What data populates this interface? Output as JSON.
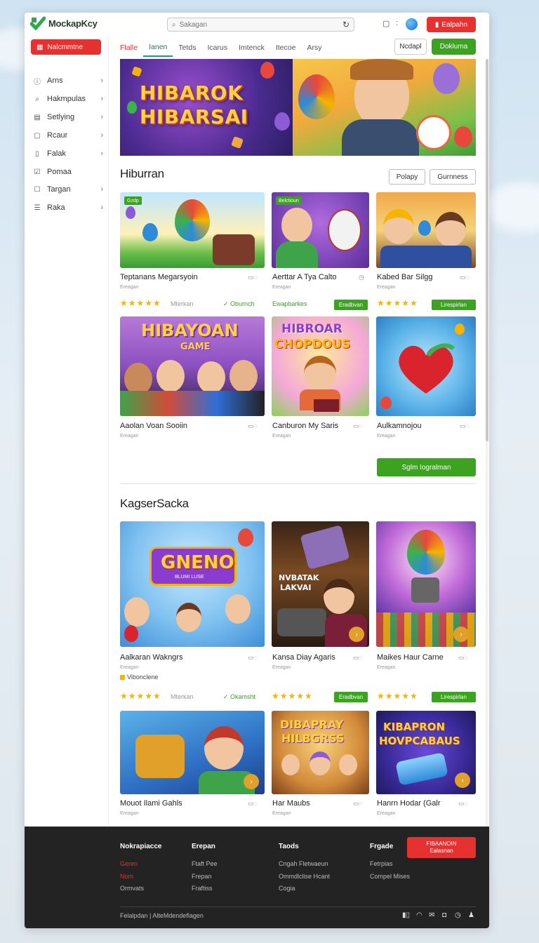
{
  "header": {
    "logo_text": "MockapKcy",
    "search_placeholder": "Sakagan",
    "account_label": "Ealpahn"
  },
  "sidebar": {
    "active_label": "Nalcmmtne",
    "items": [
      {
        "label": "Arns",
        "icon": "info-icon"
      },
      {
        "label": "Hakmpulas",
        "icon": "search-icon"
      },
      {
        "label": "Setlying",
        "icon": "calendar-icon"
      },
      {
        "label": "Rcaur",
        "icon": "box-icon"
      },
      {
        "label": "Falak",
        "icon": "doc-icon"
      },
      {
        "label": "Pomaa",
        "icon": "check-icon"
      },
      {
        "label": "Targan",
        "icon": "tag-icon"
      },
      {
        "label": "Raka",
        "icon": "list-icon"
      }
    ]
  },
  "tabs": [
    {
      "label": "Flalle",
      "state": "red"
    },
    {
      "label": "Ianen",
      "state": "active"
    },
    {
      "label": "Tetds",
      "state": ""
    },
    {
      "label": "Icarus",
      "state": ""
    },
    {
      "label": "Imtenck",
      "state": ""
    },
    {
      "label": "Itecoe",
      "state": ""
    },
    {
      "label": "Arsy",
      "state": ""
    }
  ],
  "top_buttons": {
    "outline": "Ncdapl",
    "green": "Dokluma"
  },
  "banner": {
    "title_line1": "HIBAROK",
    "title_line2": "HIBARSAI"
  },
  "section1": {
    "title": "Hiburran",
    "btn1": "Polapy",
    "btn2": "Gurnness",
    "row1": [
      {
        "title": "Teptanans Megarsyoin",
        "sub": "Ereagan",
        "tag": "Gzdp"
      },
      {
        "title": "Aerttar A Tya Calto",
        "sub": "Ereagan",
        "tag": "Belctioun"
      },
      {
        "title": "Kabed Bar Silgg",
        "sub": "Ereagan",
        "tag": ""
      }
    ],
    "meta_row": {
      "stars": "★★★★★",
      "text1": "Mterkan",
      "text2": "Oburnch",
      "text3": "Ewapbarkes",
      "badge1": "Eradbvan",
      "stars2": "★★★★★",
      "badge2": "Lirespirlan"
    },
    "row2": [
      {
        "title": "Aaolan Voan Sooiin",
        "sub": "Ereagan",
        "art": "HIBAYOAN",
        "art2": "GAME"
      },
      {
        "title": "Canburon My Saris",
        "sub": "Ereagan",
        "art": "HIBROAR",
        "art2": "CHOPDOUS"
      },
      {
        "title": "Aulkamnojou",
        "sub": "Ereagan",
        "art": "",
        "art2": ""
      }
    ],
    "cta": "Sglm Iogralman"
  },
  "section2": {
    "title": "KagserSacka",
    "row1": [
      {
        "title": "Aalkaran Wakngrs",
        "sub": "Ereagan",
        "art": "GNENO",
        "art2": "BLUMI LUSE"
      },
      {
        "title": "Kansa Diay Agaris",
        "sub": "Ereagan",
        "art": "NVBATAK",
        "art2": "LAKVAI"
      },
      {
        "title": "Maikes Haur Carne",
        "sub": "Ereagan",
        "art": "",
        "art2": ""
      }
    ],
    "subnote": "Vibonclene",
    "meta_row": {
      "stars": "★★★★★",
      "text1": "Mterkan",
      "text2": "Okamsht",
      "stars_mid": "★★★★★",
      "badge1": "Eradbvan",
      "stars2": "★★★★★",
      "badge2": "Lirespirlan"
    },
    "row2": [
      {
        "title": "Mouot Ilami Gahls",
        "sub": "Ereagan",
        "art": "",
        "art2": ""
      },
      {
        "title": "Har Maubs",
        "sub": "Ereagan",
        "art": "DIBAPRAY",
        "art2": "HILBGRSS"
      },
      {
        "title": "Hanrn Hodar (Galr",
        "sub": "Ereagan",
        "art": "KIBAPRON",
        "art2": "HOVPCABAUS"
      }
    ]
  },
  "footer": {
    "col1": {
      "head": "Nokrapiacce",
      "links": [
        "Geren",
        "Nom",
        "Ormvats"
      ]
    },
    "col2": {
      "head": "Erepan",
      "links": [
        "Ftaft Pee",
        "Frepan",
        "Fraftiss"
      ]
    },
    "col3": {
      "head": "Taods",
      "links": [
        "Cngah Fletwaeun",
        "Ommdlclise Hcant",
        "Cogia"
      ]
    },
    "col4": {
      "head": "Frgade",
      "links": [
        "Fetrpias",
        "Compel Mises"
      ]
    },
    "btn_line1": "FIBAANOIN",
    "btn_line2": "Ealasnan",
    "copyright": "Felalpdan | AlteMdendeflagen"
  },
  "colors": {
    "accent_red": "#e5312f",
    "accent_green": "#3ba31f",
    "footer_bg": "#232323"
  }
}
